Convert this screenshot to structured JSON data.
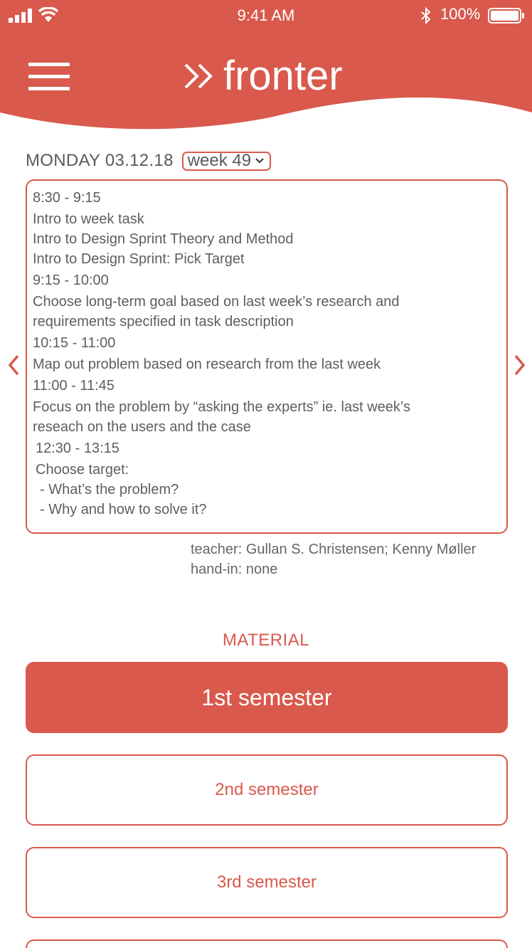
{
  "status_bar": {
    "time": "9:41 AM",
    "battery_percent": "100%",
    "battery_level": 1.0
  },
  "app": {
    "brand": "fronter",
    "brand_color": "#d9594c"
  },
  "schedule_header": {
    "date": "MONDAY 03.12.18",
    "week": "week 49"
  },
  "schedule": {
    "block1": {
      "time": "8:30 - 9:15",
      "items": [
        "Intro to week task",
        "Intro to Design Sprint Theory and Method",
        "Intro to Design Sprint: Pick Target"
      ]
    },
    "block2": {
      "time": "9:15 - 10:00",
      "line1": "Choose long-term goal based on last week’s research and",
      "line2": "requirements specified in task description"
    },
    "block3": {
      "time": "10:15 - 11:00",
      "line1": "Map out problem based on research from the last week"
    },
    "block4": {
      "time": "11:00 - 11:45",
      "line1": "Focus on the problem by “asking the experts” ie. last week’s",
      "line2": "reseach on the users and the case"
    },
    "block5": {
      "time": "12:30 - 13:15",
      "line1": "Choose target:",
      "line2": "- What’s the problem?",
      "line3": "- Why and how to solve it?"
    }
  },
  "meta": {
    "teacher": "teacher: Gullan S. Christensen; Kenny Møller",
    "handin": "hand-in: none"
  },
  "material": {
    "title": "MATERIAL",
    "semesters": [
      "1st semester",
      "2nd semester",
      "3rd semester"
    ]
  },
  "icons": {
    "menu": "hamburger-menu-icon",
    "logo": "double-chevron-icon",
    "prev": "chevron-left-icon",
    "next": "chevron-right-icon",
    "dropdown": "chevron-down-icon"
  }
}
